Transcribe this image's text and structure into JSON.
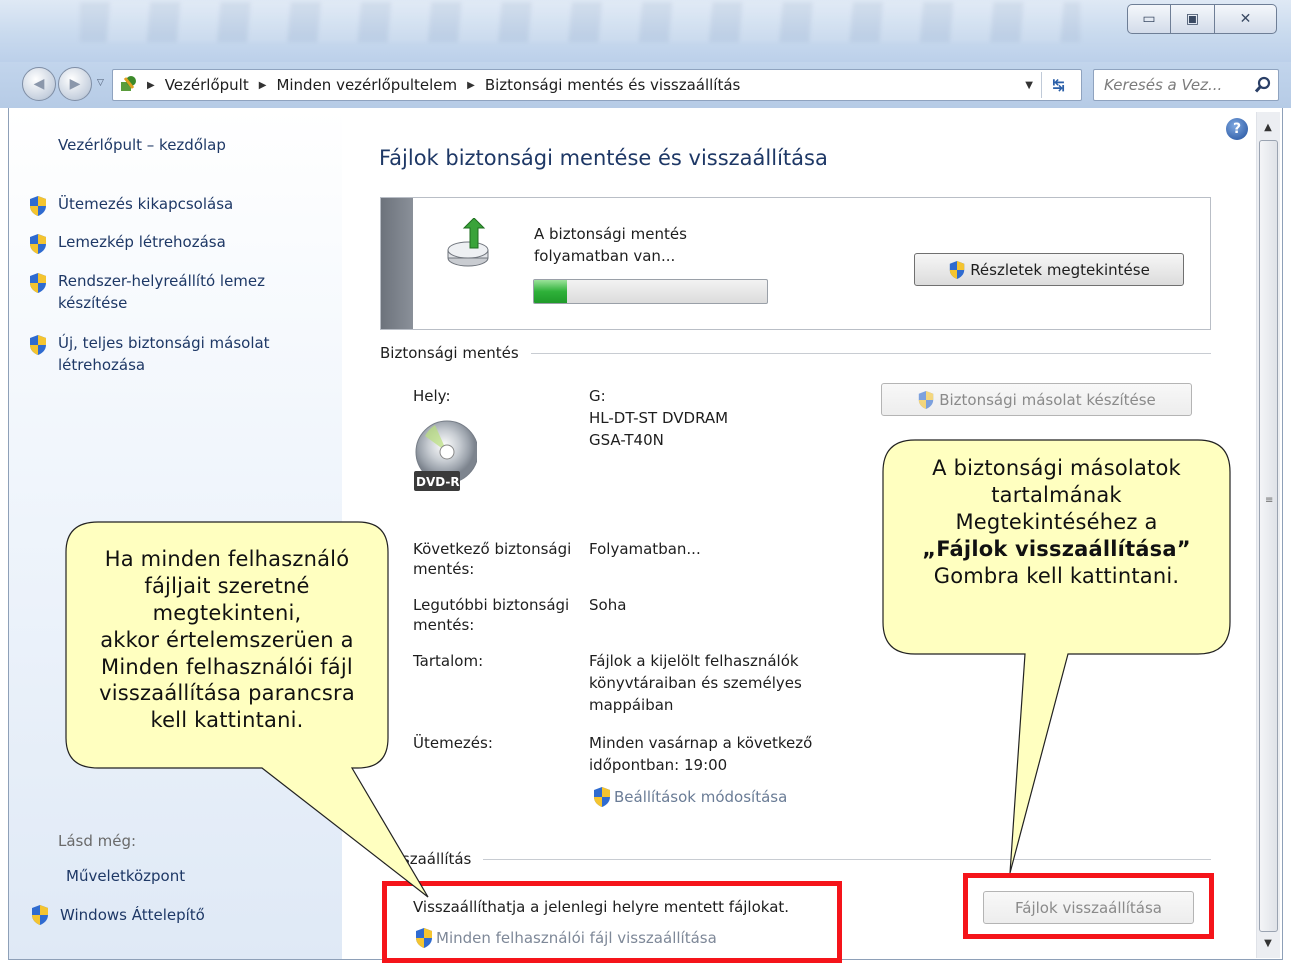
{
  "window": {
    "controls": {
      "minimize": "▭",
      "maximize": "▣",
      "close": "✕"
    }
  },
  "address": {
    "crumbs": [
      "Vezérlőpult",
      "Minden vezérlőpultelem",
      "Biztonsági mentés és visszaállítás"
    ],
    "search_placeholder": "Keresés a Vez..."
  },
  "sidebar": {
    "home": "Vezérlőpult – kezdőlap",
    "tasks": [
      "Ütemezés kikapcsolása",
      "Lemezkép létrehozása",
      "Rendszer-helyreállító lemez készítése",
      "Új, teljes biztonsági másolat létrehozása"
    ],
    "see_also": "Lásd még:",
    "links": [
      "Műveletközpont",
      "Windows Áttelepítő"
    ]
  },
  "main": {
    "title": "Fájlok biztonsági mentése és visszaállítása",
    "progress": {
      "status": "A biztonsági mentés folyamatban van...",
      "fraction": 0.14,
      "details_button": "Részletek megtekintése"
    },
    "backup": {
      "heading": "Biztonsági mentés",
      "create_button": "Biztonsági másolat készítése",
      "location_label": "Hely:",
      "location_value": [
        "G:",
        "HL-DT-ST DVDRAM",
        "GSA-T40N"
      ],
      "media_label": "DVD-R",
      "next_label": "Következő biztonsági mentés:",
      "next_value": "Folyamatban...",
      "last_label": "Legutóbbi biztonsági mentés:",
      "last_value": "Soha",
      "contents_label": "Tartalom:",
      "contents_value": "Fájlok a kijelölt felhasználók könyvtáraiban és személyes mappáiban",
      "schedule_label": "Ütemezés:",
      "schedule_value": "Minden vasárnap a következő időpontban: 19:00",
      "change_settings": "Beállítások módosítása"
    },
    "restore": {
      "heading": "Visszaállítás",
      "text": "Visszaállíthatja a jelenlegi helyre mentett fájlokat.",
      "all_users_link": "Minden felhasználói fájl visszaállítása",
      "restore_button": "Fájlok visszaállítása"
    }
  },
  "callouts": {
    "left": [
      "Ha minden felhasználó",
      "fájljait szeretné",
      "megtekinteni,",
      "akkor értelemszerüen a",
      "Minden felhasználói fájl",
      "visszaállítása parancsra",
      "kell kattintani."
    ],
    "right_line1": "A biztonsági másolatok",
    "right_line2": "tartalmának",
    "right_line3": "Megtekintéséhez a",
    "right_bold": "„Fájlok visszaállítása”",
    "right_line5": "Gombra kell kattintani.",
    "fill_color": "#ffffc0",
    "highlight_color": "#f5141a"
  }
}
